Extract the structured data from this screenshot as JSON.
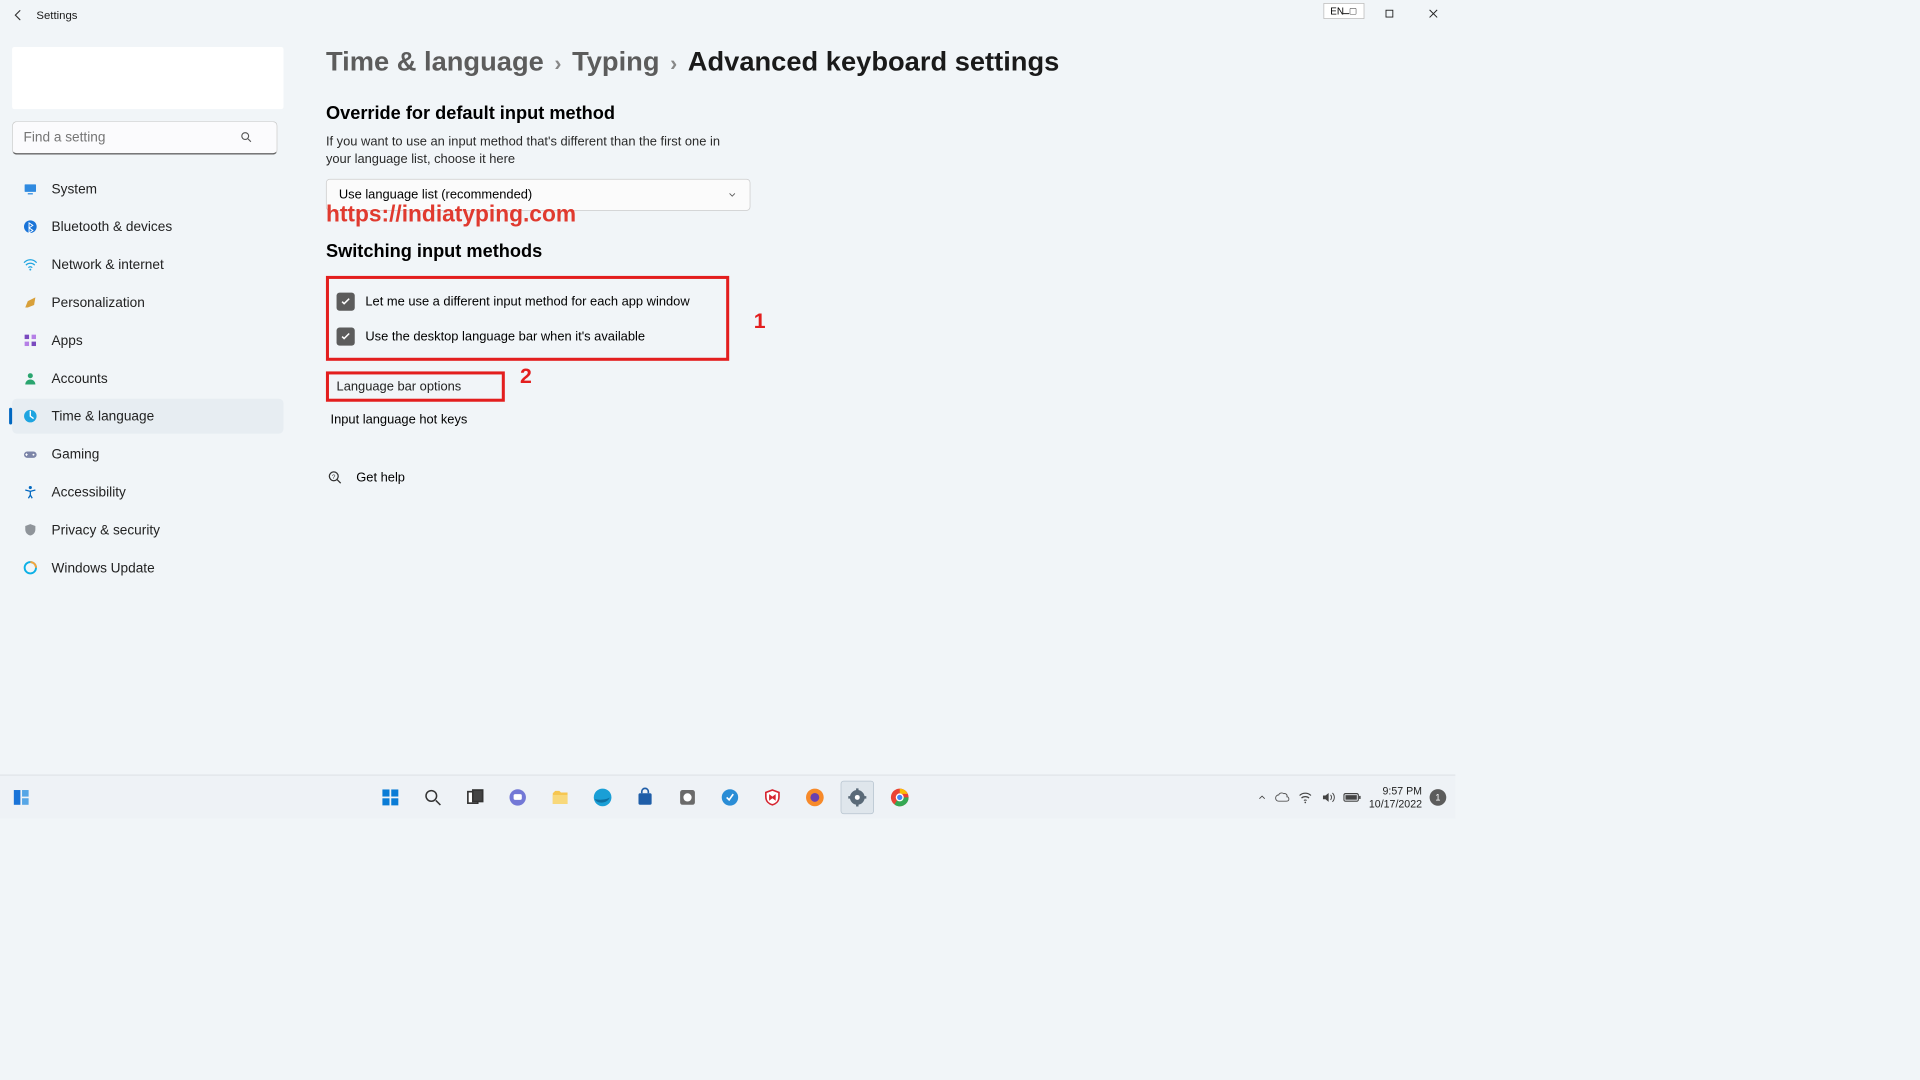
{
  "titlebar": {
    "title": "Settings",
    "ime_label": "EN"
  },
  "sidebar": {
    "search_placeholder": "Find a setting",
    "items": [
      {
        "label": "System",
        "color": "#2f8ae0"
      },
      {
        "label": "Bluetooth & devices",
        "color": "#1a74d8"
      },
      {
        "label": "Network & internet",
        "color": "#1ea4e0"
      },
      {
        "label": "Personalization",
        "color": "#d8a03a"
      },
      {
        "label": "Apps",
        "color": "#7a4abf"
      },
      {
        "label": "Accounts",
        "color": "#2aa56f"
      },
      {
        "label": "Time & language",
        "color": "#1ea4e0"
      },
      {
        "label": "Gaming",
        "color": "#7c85a8"
      },
      {
        "label": "Accessibility",
        "color": "#0067c0"
      },
      {
        "label": "Privacy & security",
        "color": "#8f949a"
      },
      {
        "label": "Windows Update",
        "color": "#0cb0e6"
      }
    ]
  },
  "breadcrumb": {
    "l1": "Time & language",
    "l2": "Typing",
    "l3": "Advanced keyboard settings"
  },
  "override": {
    "heading": "Override for default input method",
    "desc": "If you want to use an input method that's different than the first one in your language list, choose it here",
    "dropdown_value": "Use language list (recommended)"
  },
  "overlay_url": "https://indiatyping.com",
  "switching": {
    "heading": "Switching input methods",
    "check1": "Let me use a different input method for each app window",
    "check2": "Use the desktop language bar when it's available",
    "link1": "Language bar options",
    "link2": "Input language hot keys"
  },
  "annotations": {
    "a1": "1",
    "a2": "2"
  },
  "help": {
    "label": "Get help"
  },
  "taskbar": {
    "time": "9:57 PM",
    "date": "10/17/2022",
    "notif_count": "1"
  }
}
